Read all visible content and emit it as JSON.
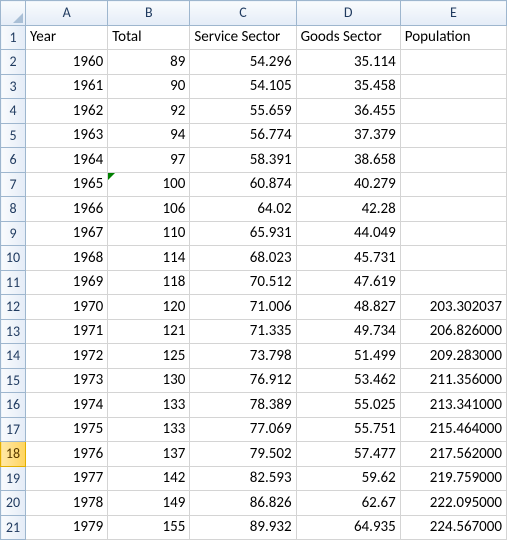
{
  "columns": [
    "A",
    "B",
    "C",
    "D",
    "E"
  ],
  "headers": {
    "A": "Year",
    "B": "Total",
    "C": "Service Sector",
    "D": "Goods Sector",
    "E": "Population"
  },
  "selected_row_index": 17,
  "error_cell": {
    "row": 6,
    "col": "B"
  },
  "rows": [
    {
      "n": 1,
      "A": "Year",
      "B": "Total",
      "C": "Service Sector",
      "D": "Goods Sector",
      "E": "Population"
    },
    {
      "n": 2,
      "A": "1960",
      "B": "89",
      "C": "54.296",
      "D": "35.114",
      "E": ""
    },
    {
      "n": 3,
      "A": "1961",
      "B": "90",
      "C": "54.105",
      "D": "35.458",
      "E": ""
    },
    {
      "n": 4,
      "A": "1962",
      "B": "92",
      "C": "55.659",
      "D": "36.455",
      "E": ""
    },
    {
      "n": 5,
      "A": "1963",
      "B": "94",
      "C": "56.774",
      "D": "37.379",
      "E": ""
    },
    {
      "n": 6,
      "A": "1964",
      "B": "97",
      "C": "58.391",
      "D": "38.658",
      "E": ""
    },
    {
      "n": 7,
      "A": "1965",
      "B": "100",
      "C": "60.874",
      "D": "40.279",
      "E": ""
    },
    {
      "n": 8,
      "A": "1966",
      "B": "106",
      "C": "64.02",
      "D": "42.28",
      "E": ""
    },
    {
      "n": 9,
      "A": "1967",
      "B": "110",
      "C": "65.931",
      "D": "44.049",
      "E": ""
    },
    {
      "n": 10,
      "A": "1968",
      "B": "114",
      "C": "68.023",
      "D": "45.731",
      "E": ""
    },
    {
      "n": 11,
      "A": "1969",
      "B": "118",
      "C": "70.512",
      "D": "47.619",
      "E": ""
    },
    {
      "n": 12,
      "A": "1970",
      "B": "120",
      "C": "71.006",
      "D": "48.827",
      "E": "203.302037"
    },
    {
      "n": 13,
      "A": "1971",
      "B": "121",
      "C": "71.335",
      "D": "49.734",
      "E": "206.826000"
    },
    {
      "n": 14,
      "A": "1972",
      "B": "125",
      "C": "73.798",
      "D": "51.499",
      "E": "209.283000"
    },
    {
      "n": 15,
      "A": "1973",
      "B": "130",
      "C": "76.912",
      "D": "53.462",
      "E": "211.356000"
    },
    {
      "n": 16,
      "A": "1974",
      "B": "133",
      "C": "78.389",
      "D": "55.025",
      "E": "213.341000"
    },
    {
      "n": 17,
      "A": "1975",
      "B": "133",
      "C": "77.069",
      "D": "55.751",
      "E": "215.464000"
    },
    {
      "n": 18,
      "A": "1976",
      "B": "137",
      "C": "79.502",
      "D": "57.477",
      "E": "217.562000"
    },
    {
      "n": 19,
      "A": "1977",
      "B": "142",
      "C": "82.593",
      "D": "59.62",
      "E": "219.759000"
    },
    {
      "n": 20,
      "A": "1978",
      "B": "149",
      "C": "86.826",
      "D": "62.67",
      "E": "222.095000"
    },
    {
      "n": 21,
      "A": "1979",
      "B": "155",
      "C": "89.932",
      "D": "64.935",
      "E": "224.567000"
    }
  ],
  "chart_data": {
    "type": "table",
    "title": "",
    "columns": [
      "Year",
      "Total",
      "Service Sector",
      "Goods Sector",
      "Population"
    ],
    "data": [
      [
        1960,
        89,
        54.296,
        35.114,
        null
      ],
      [
        1961,
        90,
        54.105,
        35.458,
        null
      ],
      [
        1962,
        92,
        55.659,
        36.455,
        null
      ],
      [
        1963,
        94,
        56.774,
        37.379,
        null
      ],
      [
        1964,
        97,
        58.391,
        38.658,
        null
      ],
      [
        1965,
        100,
        60.874,
        40.279,
        null
      ],
      [
        1966,
        106,
        64.02,
        42.28,
        null
      ],
      [
        1967,
        110,
        65.931,
        44.049,
        null
      ],
      [
        1968,
        114,
        68.023,
        45.731,
        null
      ],
      [
        1969,
        118,
        70.512,
        47.619,
        null
      ],
      [
        1970,
        120,
        71.006,
        48.827,
        203.302037
      ],
      [
        1971,
        121,
        71.335,
        49.734,
        206.826
      ],
      [
        1972,
        125,
        73.798,
        51.499,
        209.283
      ],
      [
        1973,
        130,
        76.912,
        53.462,
        211.356
      ],
      [
        1974,
        133,
        78.389,
        55.025,
        213.341
      ],
      [
        1975,
        133,
        77.069,
        55.751,
        215.464
      ],
      [
        1976,
        137,
        79.502,
        57.477,
        217.562
      ],
      [
        1977,
        142,
        82.593,
        59.62,
        219.759
      ],
      [
        1978,
        149,
        86.826,
        62.67,
        222.095
      ],
      [
        1979,
        155,
        89.932,
        64.935,
        224.567
      ]
    ]
  }
}
